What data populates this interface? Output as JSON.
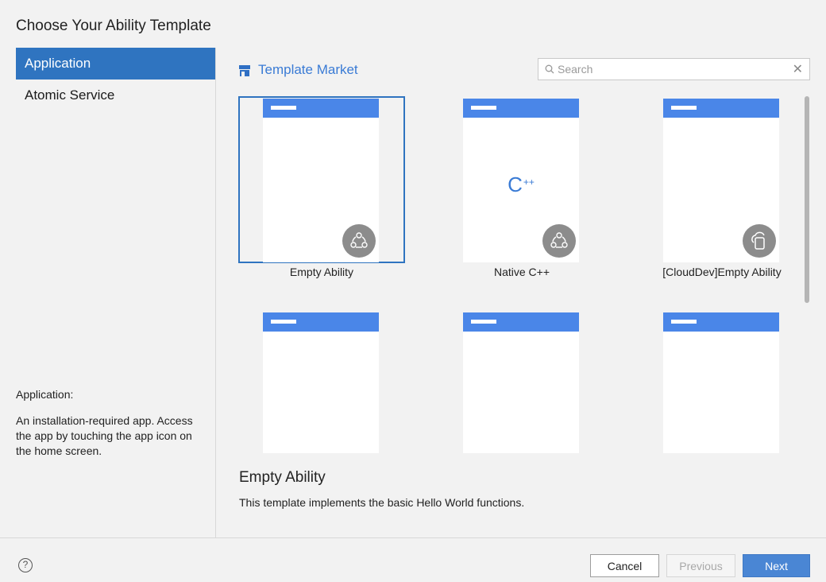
{
  "dialog": {
    "title": "Choose Your Ability Template"
  },
  "sidebar": {
    "items": [
      {
        "label": "Application",
        "active": true
      },
      {
        "label": "Atomic Service",
        "active": false
      }
    ],
    "description_title": "Application:",
    "description": "An installation-required app. Access the app by touching the app icon on the home screen."
  },
  "market": {
    "label": "Template Market",
    "icon": "store-icon"
  },
  "search": {
    "placeholder": "Search",
    "value": ""
  },
  "templates": [
    {
      "label": "Empty Ability",
      "selected": true,
      "badge_icon": "ability-network-icon"
    },
    {
      "label": "Native C++",
      "selected": false,
      "badge_icon": "ability-network-icon",
      "center_glyph": "C",
      "center_sup": "++"
    },
    {
      "label": "[CloudDev]Empty Ability",
      "selected": false,
      "badge_icon": "cloud-device-icon"
    },
    {
      "label": "",
      "selected": false,
      "badge_icon": "lock-icon"
    },
    {
      "label": "",
      "selected": false,
      "badge_icon": "window-icon"
    },
    {
      "label": "",
      "selected": false,
      "badge_icon": "window-icon"
    }
  ],
  "detail": {
    "title": "Empty Ability",
    "description": "This template implements the basic Hello World functions."
  },
  "footer": {
    "help_icon": "help-icon",
    "cancel_label": "Cancel",
    "previous_label": "Previous",
    "next_label": "Next"
  },
  "colors": {
    "accent": "#2f74c0",
    "link": "#3a7bd5",
    "phone_bar": "#4a86e8",
    "next_button": "#4a86d4"
  }
}
